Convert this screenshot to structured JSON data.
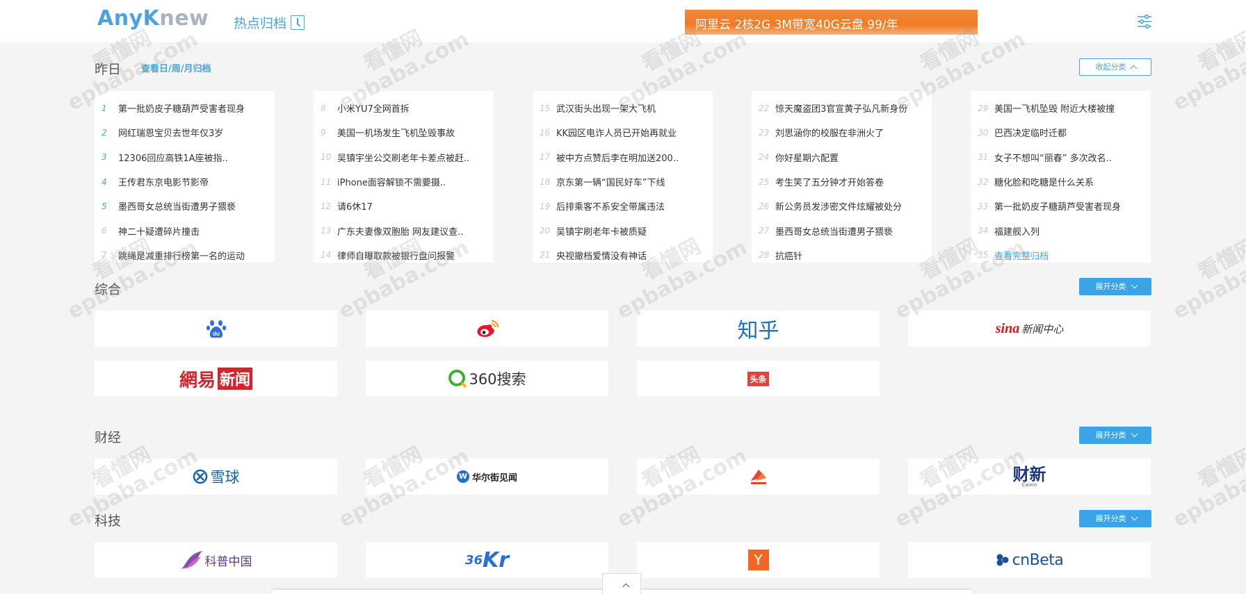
{
  "header": {
    "logo_part1": "Any",
    "logo_part2": "K",
    "logo_part3": "new",
    "archive_label": "热点归档",
    "ad_text": "阿里云 2核2G 3M带宽40G云盘 99/年"
  },
  "yesterday": {
    "title": "昨日",
    "archive_link": "查看日/周/月归档",
    "collapse_label": "收起分类",
    "columns": [
      [
        {
          "num": "1",
          "text": "第一批奶皮子糖葫芦受害者现身"
        },
        {
          "num": "2",
          "text": "网红瑞恩宝贝去世年仅3岁"
        },
        {
          "num": "3",
          "text": "12306回应高铁1A座被指.."
        },
        {
          "num": "4",
          "text": "王传君东京电影节影帝"
        },
        {
          "num": "5",
          "text": "墨西哥女总统当街遭男子猥亵"
        },
        {
          "num": "6",
          "text": "神二十疑遭碎片撞击"
        },
        {
          "num": "7",
          "text": "跳绳是减重排行榜第一名的运动"
        }
      ],
      [
        {
          "num": "8",
          "text": "小米YU7全网首拆"
        },
        {
          "num": "9",
          "text": "美国一机场发生飞机坠毁事故"
        },
        {
          "num": "10",
          "text": "吴镇宇坐公交刷老年卡差点被赶.."
        },
        {
          "num": "11",
          "text": "iPhone面容解锁不需要摄.."
        },
        {
          "num": "12",
          "text": "请6休17"
        },
        {
          "num": "13",
          "text": "广东夫妻像双胞胎 网友建议查.."
        },
        {
          "num": "14",
          "text": "律师自曝取款被银行盘问报警"
        }
      ],
      [
        {
          "num": "15",
          "text": "武汉街头出现一架大飞机"
        },
        {
          "num": "16",
          "text": "KK园区电诈人员已开始再就业"
        },
        {
          "num": "17",
          "text": "被中方点赞后李在明加送200.."
        },
        {
          "num": "18",
          "text": "京东第一辆“国民好车”下线"
        },
        {
          "num": "19",
          "text": "后排乘客不系安全带属违法"
        },
        {
          "num": "20",
          "text": "吴镇宇刷老年卡被质疑"
        },
        {
          "num": "21",
          "text": "央视撤档爱情没有神话"
        }
      ],
      [
        {
          "num": "22",
          "text": "惊天魔盗团3官宣黄子弘凡新身份"
        },
        {
          "num": "23",
          "text": "刘思涵你的校服在非洲火了"
        },
        {
          "num": "24",
          "text": "你好星期六配置"
        },
        {
          "num": "25",
          "text": "考生笑了五分钟才开始答卷"
        },
        {
          "num": "26",
          "text": "新公务员发涉密文件炫耀被处分"
        },
        {
          "num": "27",
          "text": "墨西哥女总统当街遭男子猥亵"
        },
        {
          "num": "28",
          "text": "抗癌针"
        }
      ],
      [
        {
          "num": "29",
          "text": "美国一飞机坠毁 附近大楼被撞"
        },
        {
          "num": "30",
          "text": "巴西决定临时迁都"
        },
        {
          "num": "31",
          "text": "女子不想叫“丽春” 多次改名.."
        },
        {
          "num": "32",
          "text": "糖化脸和吃糖是什么关系"
        },
        {
          "num": "33",
          "text": "第一批奶皮子糖葫芦受害者现身"
        },
        {
          "num": "34",
          "text": "福建舰入列"
        },
        {
          "num": "35",
          "text": "查看完整归档"
        }
      ]
    ]
  },
  "sections": {
    "general": {
      "title": "综合",
      "expand_label": "展开分类"
    },
    "finance": {
      "title": "财经",
      "expand_label": "展开分类"
    },
    "tech": {
      "title": "科技",
      "expand_label": "展开分类"
    }
  },
  "sources": {
    "baidu": "du",
    "zhihu": "知乎",
    "sina": "新闻中心",
    "sina_brand": "sina",
    "netease_a": "網易",
    "netease_b": "新闻",
    "so360": "360搜索",
    "toutiao": "头条",
    "xueqiu": "雪球",
    "wallstreet": "华尔街见闻",
    "caixin": "财新",
    "caixin_en": "Caixin",
    "kepu": "科普中国",
    "kr36_a": "36",
    "kr36_b": "Kr",
    "hn": "Y",
    "cnbeta": "cnBeta"
  },
  "watermark": {
    "line1": "看懂网",
    "line2": "epbaba.com"
  },
  "colors": {
    "accent": "#4aa3df",
    "button": "#3ba3e6",
    "ad": "#f07a25"
  }
}
